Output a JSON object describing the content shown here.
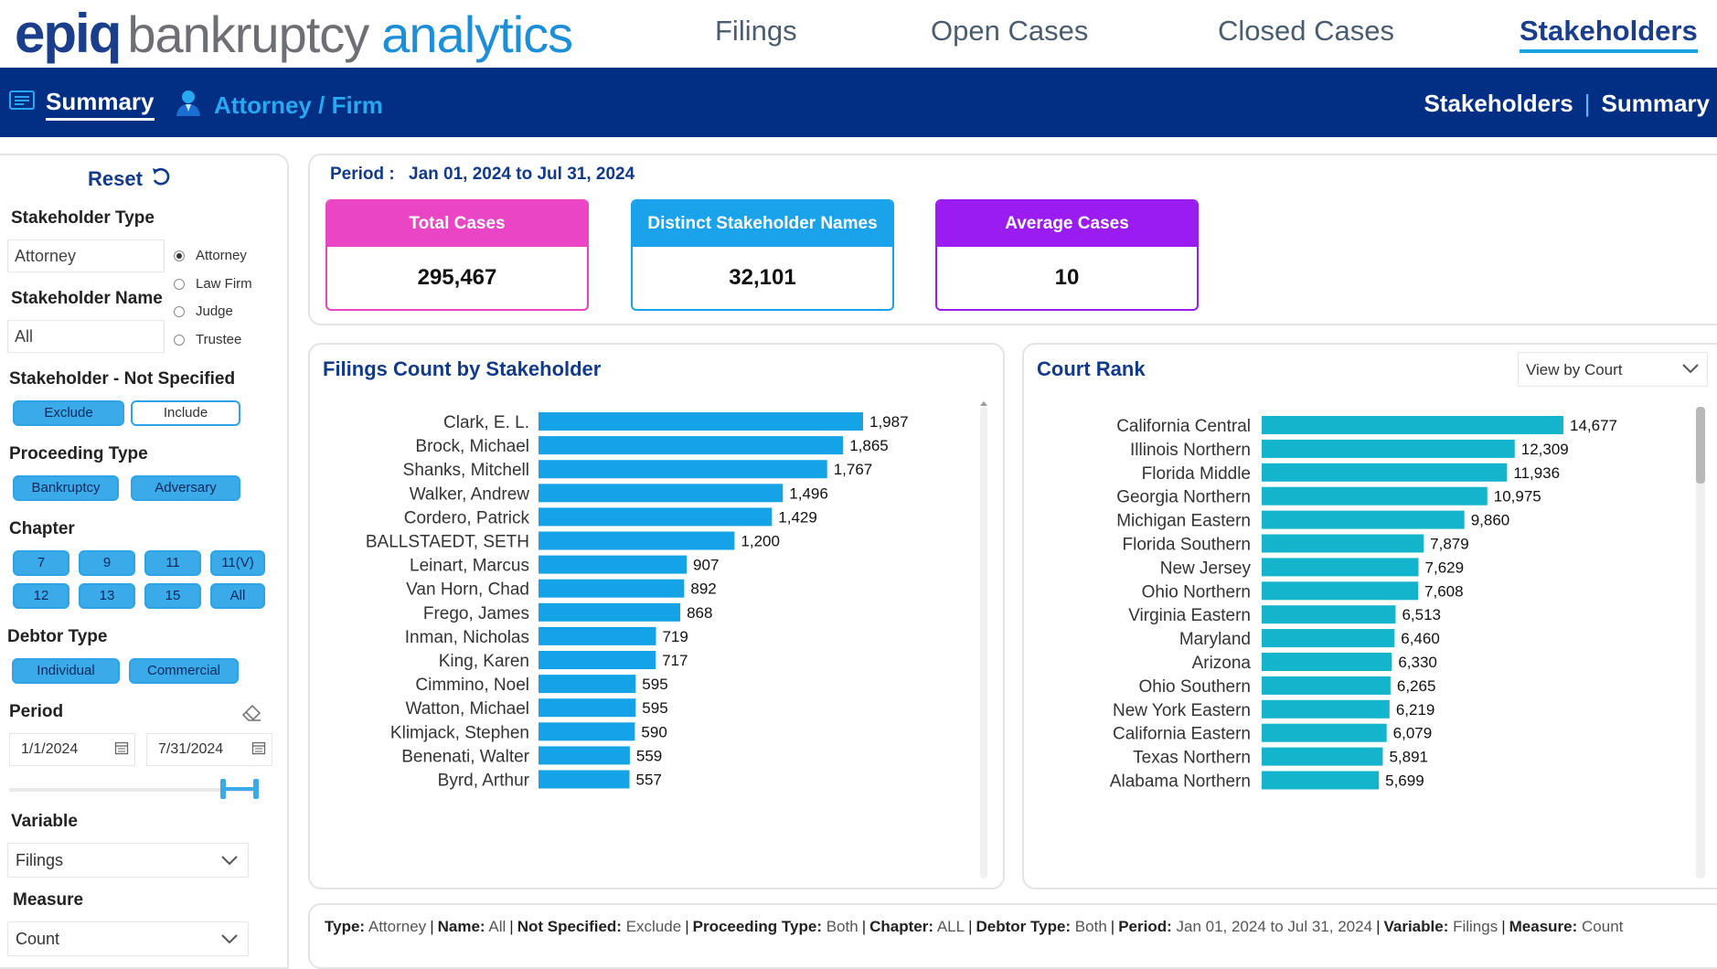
{
  "brand": {
    "part1": "epiq",
    "part2": "bankruptcy",
    "part3": "analytics"
  },
  "nav": [
    {
      "label": "Filings",
      "active": false
    },
    {
      "label": "Open Cases",
      "active": false
    },
    {
      "label": "Closed Cases",
      "active": false
    },
    {
      "label": "Stakeholders",
      "active": true
    }
  ],
  "subnav": {
    "summary": "Summary",
    "attorney": "Attorney / Firm"
  },
  "breadcrumb": {
    "section": "Stakeholders",
    "separator": "|",
    "page": "Summary"
  },
  "filters": {
    "reset": "Reset",
    "stakeholder_type_label": "Stakeholder Type",
    "stakeholder_type_value": "Attorney",
    "stakeholder_type_options": [
      "Attorney",
      "Law Firm",
      "Judge",
      "Trustee"
    ],
    "stakeholder_type_selected": "Attorney",
    "stakeholder_name_label": "Stakeholder Name",
    "stakeholder_name_value": "All",
    "not_specified_label": "Stakeholder - Not Specified",
    "not_specified_options": [
      "Exclude",
      "Include"
    ],
    "proceeding_label": "Proceeding Type",
    "proceeding_options": [
      "Bankruptcy",
      "Adversary"
    ],
    "chapter_label": "Chapter",
    "chapter_options": [
      "7",
      "9",
      "11",
      "11(V)",
      "12",
      "13",
      "15",
      "All"
    ],
    "debtor_label": "Debtor Type",
    "debtor_options": [
      "Individual",
      "Commercial"
    ],
    "period_label": "Period",
    "period_start": "1/1/2024",
    "period_end": "7/31/2024",
    "variable_label": "Variable",
    "variable_value": "Filings",
    "measure_label": "Measure",
    "measure_value": "Count"
  },
  "period": {
    "label": "Period :",
    "value": "Jan 01, 2024 to Jul 31, 2024"
  },
  "kpis": [
    {
      "title": "Total Cases",
      "value": "295,467",
      "color": "#e945c4"
    },
    {
      "title": "Distinct Stakeholder Names",
      "value": "32,101",
      "color": "#1aa3ea"
    },
    {
      "title": "Average Cases",
      "value": "10",
      "color": "#9a1cf0"
    }
  ],
  "filings_chart": {
    "title": "Filings Count by Stakeholder"
  },
  "court_chart": {
    "title": "Court Rank",
    "view_by": "View by Court"
  },
  "chart_data": [
    {
      "type": "bar",
      "orientation": "horizontal",
      "title": "Filings Count by Stakeholder",
      "color": "#13a3e6",
      "categories": [
        "Clark, E. L.",
        "Brock, Michael",
        "Shanks, Mitchell",
        "Walker, Andrew",
        "Cordero, Patrick",
        "BALLSTAEDT, SETH",
        "Leinart, Marcus",
        "Van Horn, Chad",
        "Frego, James",
        "Inman, Nicholas",
        "King, Karen",
        "Cimmino, Noel",
        "Watton, Michael",
        "Klimjack, Stephen",
        "Benenati, Walter",
        "Byrd, Arthur"
      ],
      "values": [
        1987,
        1865,
        1767,
        1496,
        1429,
        1200,
        907,
        892,
        868,
        719,
        717,
        595,
        595,
        590,
        559,
        557
      ],
      "labels": [
        "1,987",
        "1,865",
        "1,767",
        "1,496",
        "1,429",
        "1,200",
        "907",
        "892",
        "868",
        "719",
        "717",
        "595",
        "595",
        "590",
        "559",
        "557"
      ],
      "xlim": [
        0,
        1987
      ]
    },
    {
      "type": "bar",
      "orientation": "horizontal",
      "title": "Court Rank",
      "color": "#14b4cc",
      "categories": [
        "California Central",
        "Illinois Northern",
        "Florida Middle",
        "Georgia Northern",
        "Michigan Eastern",
        "Florida Southern",
        "New Jersey",
        "Ohio Northern",
        "Virginia Eastern",
        "Maryland",
        "Arizona",
        "Ohio Southern",
        "New York Eastern",
        "California Eastern",
        "Texas Northern",
        "Alabama Northern"
      ],
      "values": [
        14677,
        12309,
        11936,
        10975,
        9860,
        7879,
        7629,
        7608,
        6513,
        6460,
        6330,
        6265,
        6219,
        6079,
        5891,
        5699
      ],
      "labels": [
        "14,677",
        "12,309",
        "11,936",
        "10,975",
        "9,860",
        "7,879",
        "7,629",
        "7,608",
        "6,513",
        "6,460",
        "6,330",
        "6,265",
        "6,219",
        "6,079",
        "5,891",
        "5,699"
      ],
      "xlim": [
        0,
        14677
      ]
    }
  ],
  "footer": [
    {
      "key": "Type:",
      "value": "Attorney"
    },
    {
      "key": "Name:",
      "value": "All"
    },
    {
      "key": "Not Specified:",
      "value": "Exclude"
    },
    {
      "key": "Proceeding Type:",
      "value": "Both"
    },
    {
      "key": "Chapter:",
      "value": "ALL"
    },
    {
      "key": "Debtor Type:",
      "value": "Both"
    },
    {
      "key": "Period:",
      "value": "Jan 01, 2024 to Jul 31, 2024"
    },
    {
      "key": "Variable:",
      "value": "Filings"
    },
    {
      "key": "Measure:",
      "value": "Count"
    }
  ]
}
